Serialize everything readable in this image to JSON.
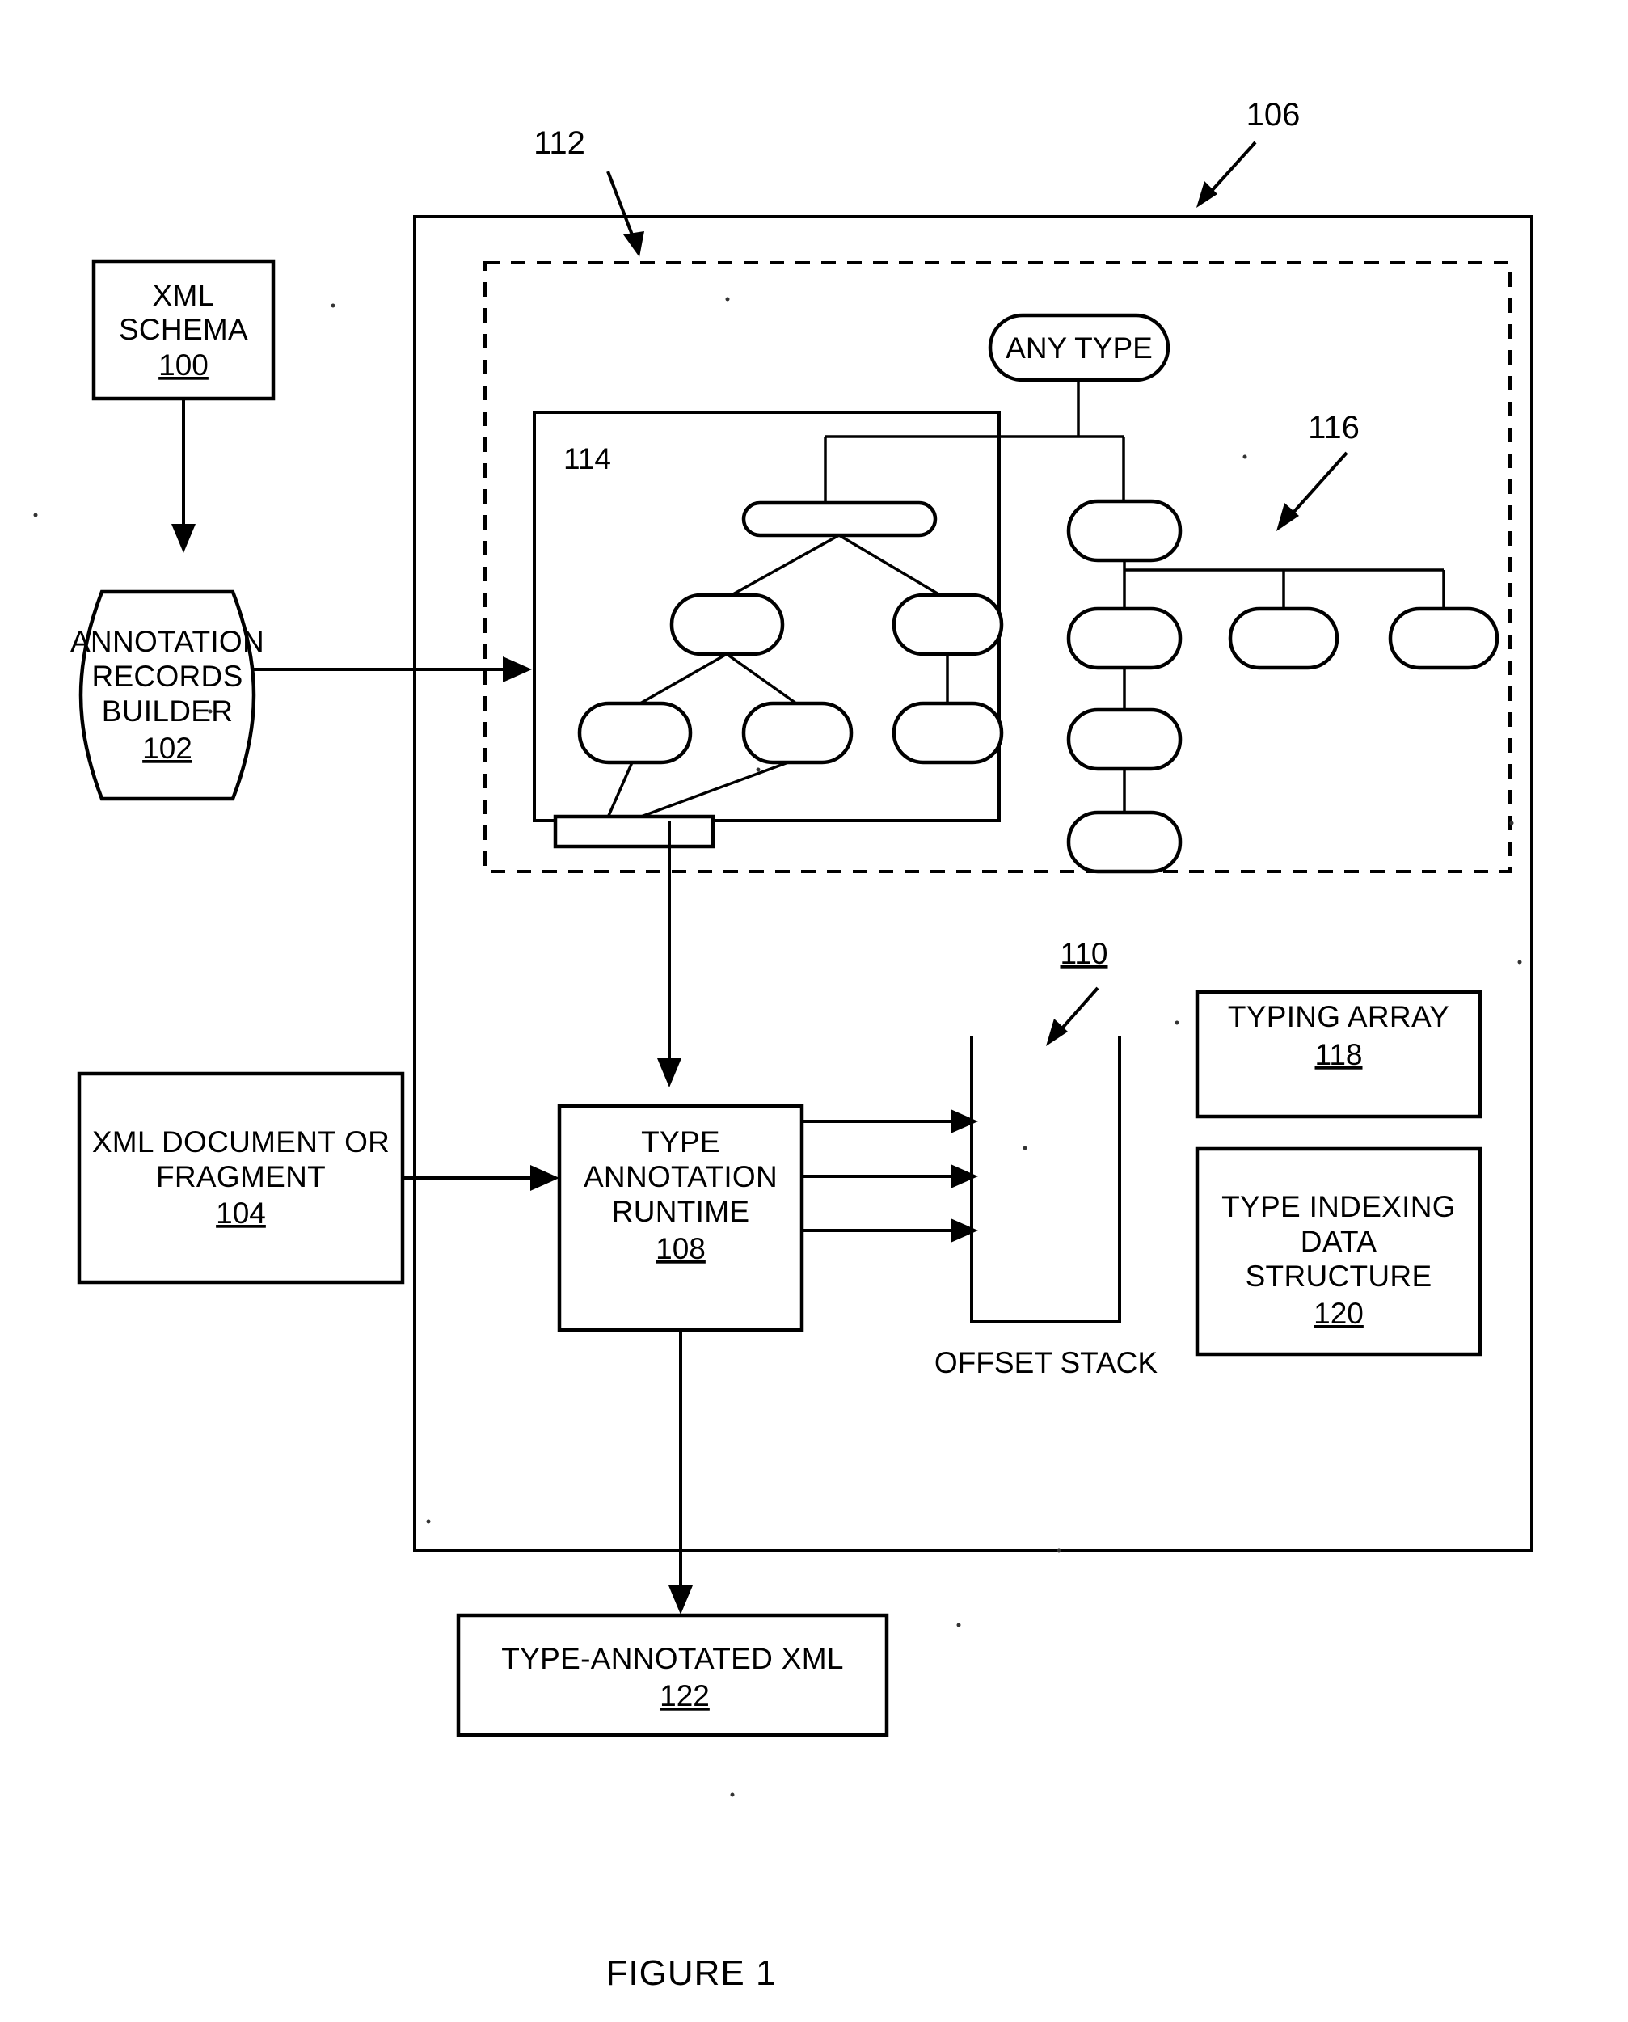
{
  "figure": {
    "caption": "FIGURE 1"
  },
  "callouts": {
    "system_106": "106",
    "schema_model_112": "112",
    "type_tree_114": "114",
    "type_hierarchy_116": "116",
    "offset_stack_110": "110"
  },
  "blocks": {
    "xml_schema": {
      "line1": "XML",
      "line2": "SCHEMA",
      "ref": "100"
    },
    "annotation_records_builder": {
      "line1": "ANNOTATION",
      "line2": "RECORDS",
      "line3": "BUILDER",
      "ref": "102"
    },
    "xml_document_or_fragment": {
      "line1": "XML DOCUMENT OR",
      "line2": "FRAGMENT",
      "ref": "104"
    },
    "type_annotation_runtime": {
      "line1": "TYPE",
      "line2": "ANNOTATION",
      "line3": "RUNTIME",
      "ref": "108"
    },
    "offset_stack": {
      "label": "OFFSET STACK"
    },
    "typing_array": {
      "line1": "TYPING ARRAY",
      "ref": "118"
    },
    "type_indexing_data_structure": {
      "line1": "TYPE INDEXING",
      "line2": "DATA",
      "line3": "STRUCTURE",
      "ref": "120"
    },
    "type_annotated_xml": {
      "line1": "TYPE-ANNOTATED XML",
      "ref": "122"
    },
    "any_type": {
      "label": "ANY TYPE"
    }
  },
  "colors": {
    "ink": "#000000",
    "paper": "#ffffff"
  }
}
